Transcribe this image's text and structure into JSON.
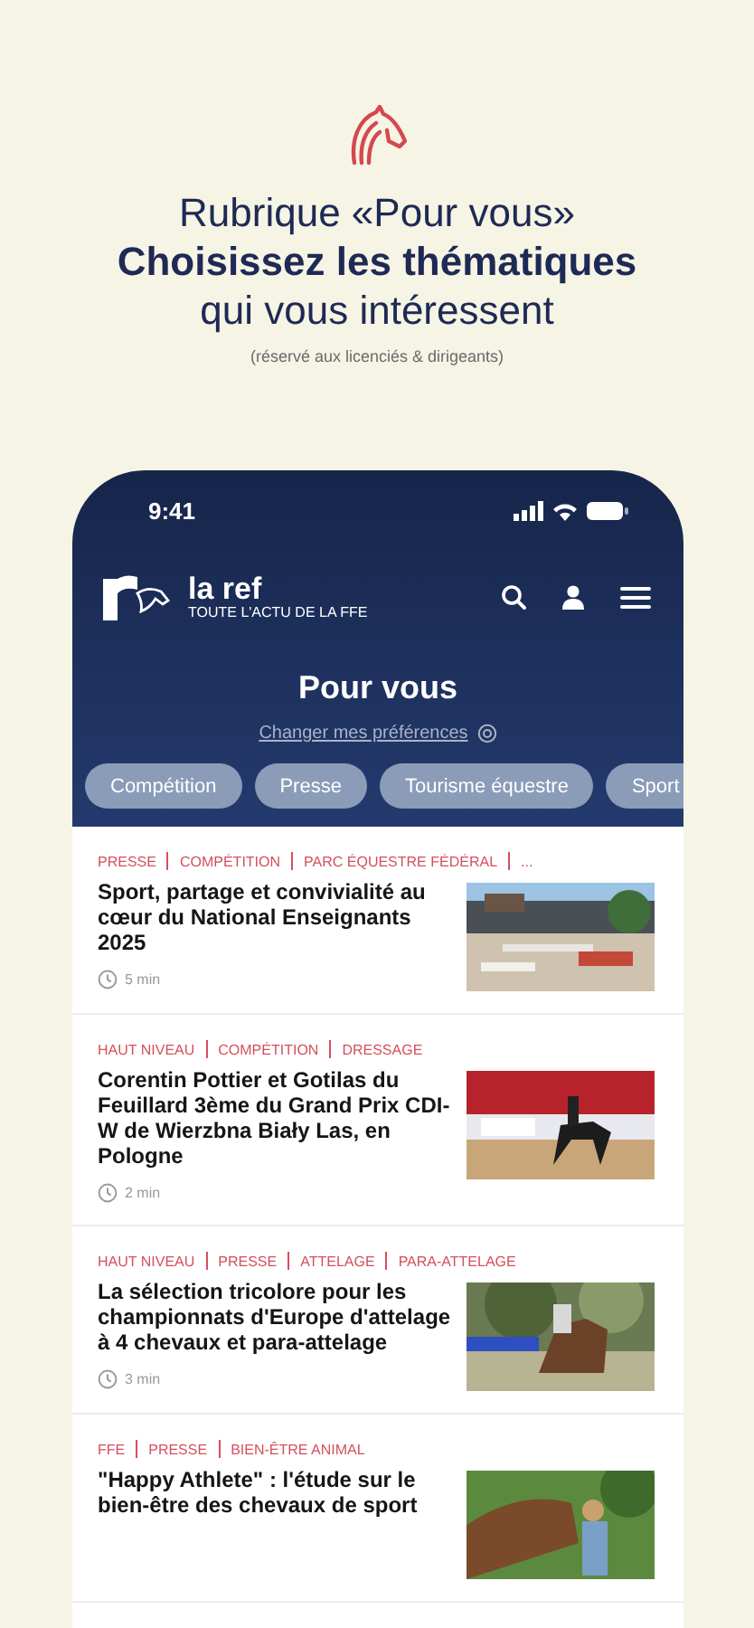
{
  "promo": {
    "line_1": "Rubrique «Pour vous»",
    "line_2": "Choisissez les thématiques",
    "line_3": "qui vous intéressent",
    "note": "(réservé aux licenciés & dirigeants)"
  },
  "status_bar": {
    "time": "9:41"
  },
  "app_header": {
    "logo_name": "la ref",
    "logo_tagline": "TOUTE L'ACTU DE LA FFE"
  },
  "page": {
    "title": "Pour vous",
    "preferences_link": "Changer mes préférences"
  },
  "chips": [
    {
      "label": "Compétition"
    },
    {
      "label": "Presse"
    },
    {
      "label": "Tourisme équestre"
    },
    {
      "label": "Sport"
    }
  ],
  "articles": [
    {
      "tags": [
        "PRESSE",
        "COMPÉTITION",
        "PARC ÉQUESTRE FÉDÉRAL",
        "..."
      ],
      "title": "Sport, partage et convivialité au cœur du National Enseignants 2025",
      "read_time": "5 min"
    },
    {
      "tags": [
        "HAUT NIVEAU",
        "COMPÉTITION",
        "DRESSAGE"
      ],
      "title": "Corentin Pottier et Gotilas du Feuillard 3ème du Grand Prix CDI-W de Wierzbna Biały Las, en Pologne",
      "read_time": "2 min"
    },
    {
      "tags": [
        "HAUT NIVEAU",
        "PRESSE",
        "ATTELAGE",
        "PARA-ATTELAGE"
      ],
      "title": "La sélection tricolore pour les championnats d'Europe d'attelage à 4 chevaux et para-attelage",
      "read_time": "3 min"
    },
    {
      "tags": [
        "FFE",
        "PRESSE",
        "BIEN-ÊTRE ANIMAL"
      ],
      "title": "\"Happy Athlete\" : l'étude sur le bien-être des chevaux de sport"
    }
  ]
}
